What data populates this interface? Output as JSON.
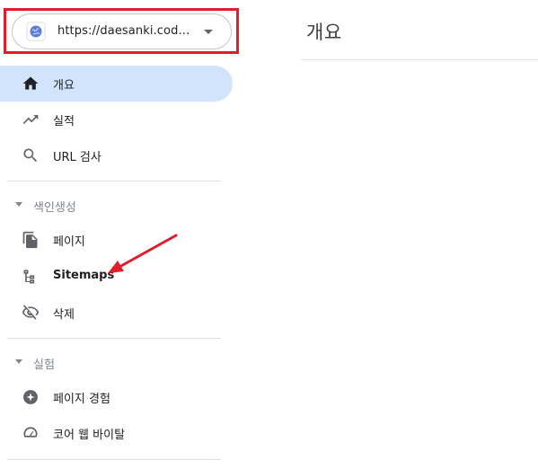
{
  "property": {
    "url": "https://daesanki.cod…",
    "highlight_color": "#e01e2b"
  },
  "main": {
    "title": "개요"
  },
  "nav": {
    "top": [
      {
        "label": "개요",
        "icon": "home-icon",
        "active": true
      },
      {
        "label": "실적",
        "icon": "trending-up-icon"
      },
      {
        "label": "URL 검사",
        "icon": "search-icon"
      }
    ],
    "indexing": {
      "header": "색인생성",
      "items": [
        {
          "label": "페이지",
          "icon": "pages-icon"
        },
        {
          "label": "Sitemaps",
          "icon": "sitemap-icon"
        },
        {
          "label": "삭제",
          "icon": "visibility-off-icon"
        }
      ]
    },
    "experience": {
      "header": "실험",
      "items": [
        {
          "label": "페이지 경험",
          "icon": "page-experience-icon"
        },
        {
          "label": "코어 웹 바이탈",
          "icon": "speed-gauge-icon"
        }
      ]
    }
  },
  "colors": {
    "active_bg": "#d2e3fc",
    "arrow": "#e01e2b"
  }
}
